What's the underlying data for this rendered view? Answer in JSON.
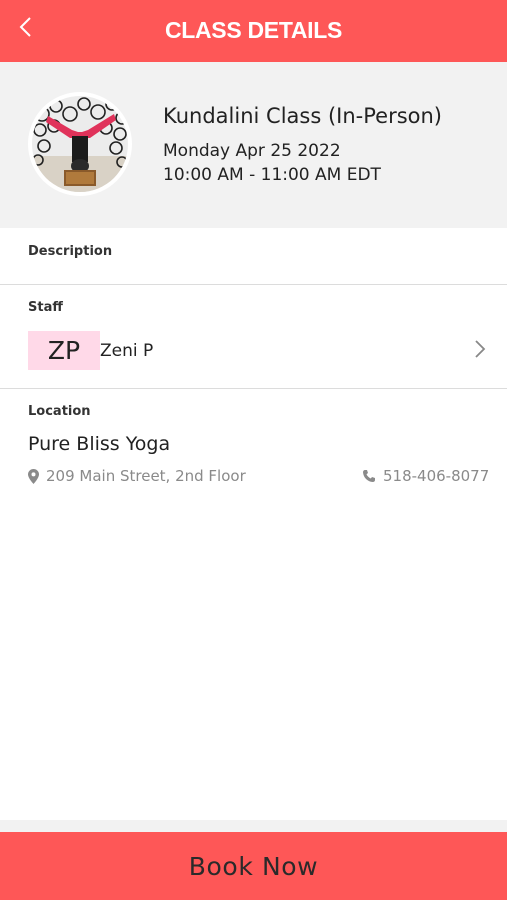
{
  "header": {
    "title": "CLASS DETAILS",
    "back_icon": "chevron-left-icon",
    "background_color": "#fe5757"
  },
  "class_info": {
    "title": "Kundalini Class (In-Person)",
    "date": "Monday Apr 25 2022",
    "time": "10:00 AM - 11:00 AM EDT",
    "image": "class-photo-icon"
  },
  "description": {
    "label": "Description"
  },
  "staff": {
    "label": "Staff",
    "initials": "ZP",
    "name": "Zeni P",
    "initials_background": "#ffd9e8",
    "chevron_icon": "chevron-right-icon"
  },
  "location": {
    "label": "Location",
    "name": "Pure Bliss Yoga",
    "address": "209 Main Street, 2nd Floor",
    "address_icon": "map-pin-icon",
    "phone": "518-406-8077",
    "phone_icon": "phone-icon"
  },
  "footer": {
    "book_label": "Book Now",
    "button_color": "#fe5757"
  }
}
